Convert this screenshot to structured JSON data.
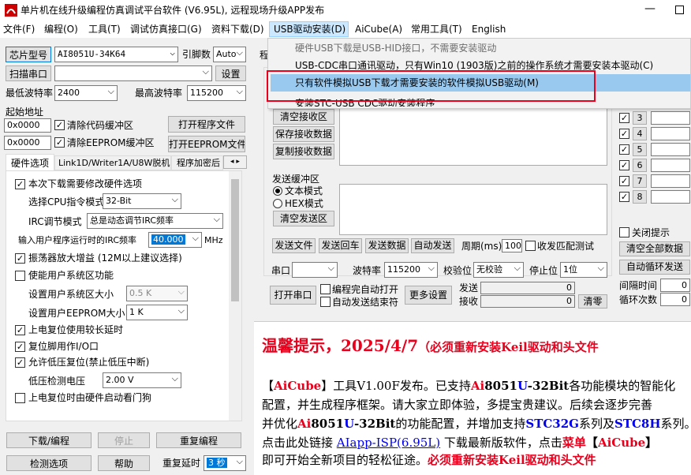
{
  "title": "单片机在线升级编程仿真调试平台软件 (V6.95L), 远程现场升级APP发布",
  "menu": [
    "文件(F)",
    "编程(O)",
    "工具(T)",
    "调试仿真接口(G)",
    "资料下载(D)",
    "USB驱动安装(D)",
    "AiCube(A)",
    "常用工具(T)",
    "English"
  ],
  "dropdown": {
    "items": [
      "硬件USB下载是USB-HID接口，不需要安装驱动",
      "USB-CDC串口通讯驱动，只有Win10 (1903版)之前的操作系统才需要安装本驱动(C)",
      "只有软件模拟USB下载才需要安装的软件模拟USB驱动(M)",
      "安装STC-USB CDC驱动安装程序"
    ]
  },
  "left": {
    "chip_btn": "芯片型号",
    "chip_val": "AI8051U-34K64",
    "pin_label": "引脚数",
    "pin_val": "Auto",
    "scan_btn": "扫描串口",
    "settings_btn": "设置",
    "min_baud_label": "最低波特率",
    "min_baud": "2400",
    "max_baud_label": "最高波特率",
    "max_baud": "115200",
    "start_addr_label": "起始地址",
    "addr1": "0x0000",
    "addr2": "0x0000",
    "clear_code": "清除代码缓冲区",
    "clear_eeprom": "清除EEPROM缓冲区",
    "open_prog": "打开程序文件",
    "open_eeprom": "打开EEPROM文件"
  },
  "tabs": [
    "硬件选项",
    "Link1D/Writer1A/U8W脱机",
    "程序加密后"
  ],
  "options": {
    "o1": "本次下载需要修改硬件选项",
    "cpu_label": "选择CPU指令模式",
    "cpu_val": "32-Bit",
    "irc_mode_label": "IRC调节模式",
    "irc_mode_val": "总是动态调节IRC频率",
    "irc_freq_label": "输入用户程序运行时的IRC频率",
    "irc_freq_val": "40.000",
    "irc_unit": "MHz",
    "o2": "振荡器放大增益 (12M以上建议选择)",
    "o3": "使能用户系统区功能",
    "sys_size_label": "设置用户系统区大小",
    "sys_size_val": "0.5 K",
    "eeprom_size_label": "设置用户EEPROM大小",
    "eeprom_size_val": "1  K",
    "o4": "上电复位使用较长延时",
    "o5": "复位脚用作I/O口",
    "o6": "允许低压复位(禁止低压中断)",
    "lvd_label": "低压检测电压",
    "lvd_val": "2.00 V",
    "o7": "上电复位时由硬件启动看门狗"
  },
  "bottom": {
    "download": "下载/编程",
    "stop": "停止",
    "reprogram": "重复编程",
    "check": "检测选项",
    "help": "帮助",
    "delay_label": "重复延时",
    "delay_val": "3 秒"
  },
  "serial": {
    "clear_recv": "清空接收区",
    "save_recv": "保存接收数据",
    "copy_recv": "复制接收数据",
    "send_label": "发送缓冲区",
    "text_mode": "文本模式",
    "hex_mode": "HEX模式",
    "clear_send": "清空发送区",
    "send_file": "发送文件",
    "send_return": "发送回车",
    "send_data": "发送数据",
    "auto_send": "自动发送",
    "period_label": "周期(ms)",
    "period_val": "100",
    "match": "收发匹配测试",
    "port_label": "串口",
    "baud_label": "波特率",
    "baud_val": "115200",
    "parity_label": "校验位",
    "parity_val": "无校验",
    "stop_label": "停止位",
    "stop_val": "1位",
    "open_port": "打开串口",
    "auto_open": "编程完自动打开",
    "auto_send_end": "自动发送结束符",
    "more": "更多设置",
    "send_count_label": "发送",
    "recv_count_label": "接收",
    "send_count": "0",
    "recv_count": "0",
    "clear_count": "清零"
  },
  "right": {
    "rows": [
      "2",
      "3",
      "4",
      "5",
      "6",
      "7",
      "8"
    ],
    "close_tip": "关闭提示",
    "clear_all": "清空全部数据",
    "auto_loop": "自动循环发送",
    "interval_label": "间隔时间",
    "interval_val": "0",
    "loop_label": "循环次数",
    "loop_val": "0"
  },
  "notice": {
    "title": "温馨提示，2025/4/7",
    "title_note": "（必须重新安装Keil驱动和头文件",
    "p1": [
      "【",
      "AiCube",
      "】工具V1.00F发布。已支持",
      "Ai",
      "8051",
      "U",
      "-32Bit",
      "各功能模块的智能化"
    ],
    "p2": "配置，并生成程序框架。请大家立即体验，多提宝贵建议。后续会逐步完善",
    "p3": [
      "并优化",
      "Ai",
      "8051",
      "U",
      "-32Bit",
      "的功能配置，并增加支持",
      "STC32G",
      "系列及",
      "STC8H",
      "系列。"
    ],
    "p4": [
      "点击此处链接 ",
      "AIapp-ISP(6.95L)",
      " 下载最新版软件，点击",
      "菜单",
      "【",
      "AiCube",
      "】"
    ],
    "p5": [
      "即可开始全新项目的轻松征途。",
      "必须重新安装Keil驱动和头文件"
    ]
  },
  "colors": {
    "red": "#e8001c",
    "blue": "#0000ee",
    "highlight": "#99c9ef"
  }
}
